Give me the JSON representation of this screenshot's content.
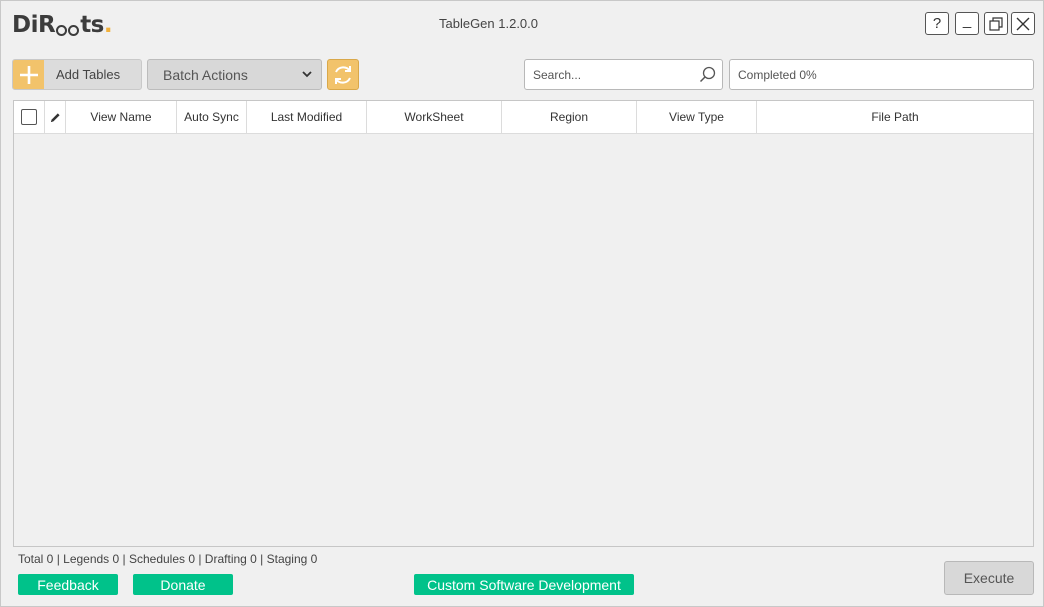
{
  "app": {
    "logo_text_left": "DiR",
    "logo_text_right": "ts",
    "logo_dot": ".",
    "title": "TableGen 1.2.0.0",
    "brand_color": "#3c3c3c",
    "accent_color": "#f2c36b",
    "green_color": "#00c28a"
  },
  "window_controls": {
    "help": "?",
    "minimize": "_",
    "restore_icon": "restore-icon",
    "close_icon": "close-icon"
  },
  "toolbar": {
    "add_tables_label": "Add Tables",
    "add_icon": "plus-icon",
    "batch_actions_label": "Batch Actions",
    "refresh_icon": "refresh-icon",
    "search_placeholder": "Search...",
    "search_icon": "search-icon",
    "progress_text": "Completed 0%",
    "progress_fraction": 0
  },
  "table": {
    "columns": [
      "View Name",
      "Auto Sync",
      "Last Modified",
      "WorkSheet",
      "Region",
      "View Type",
      "File Path"
    ],
    "rows": []
  },
  "status": {
    "summary": "Total 0 | Legends 0 | Schedules 0 | Drafting 0 | Staging 0"
  },
  "footer": {
    "feedback_label": "Feedback",
    "donate_label": "Donate",
    "custom_dev_label": "Custom Software Development",
    "execute_label": "Execute"
  }
}
